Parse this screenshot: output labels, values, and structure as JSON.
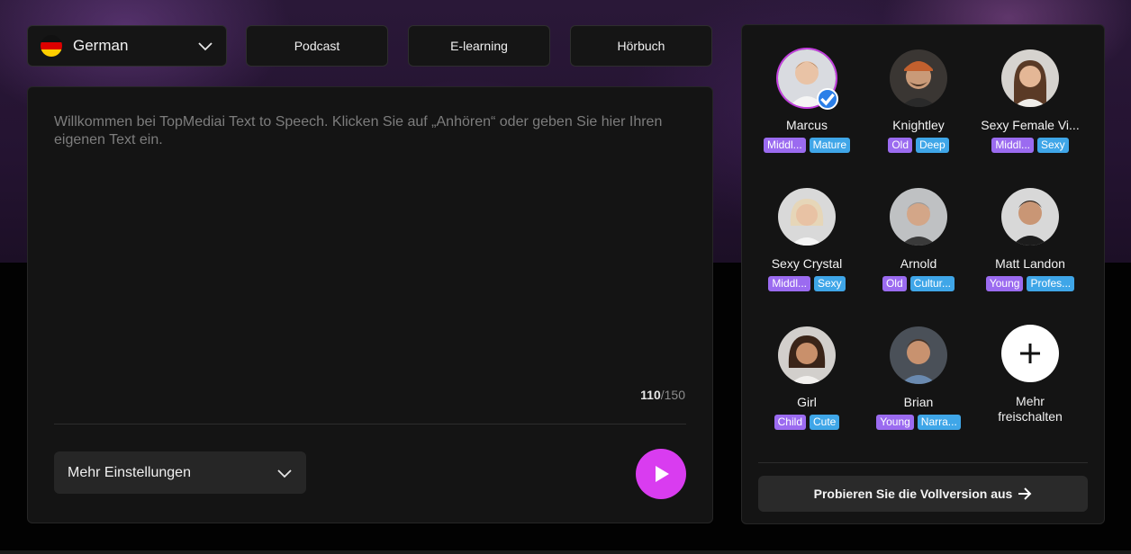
{
  "language": {
    "label": "German",
    "icon": "germany-flag-icon"
  },
  "tabs": [
    {
      "label": "Podcast"
    },
    {
      "label": "E-learning"
    },
    {
      "label": "Hörbuch"
    }
  ],
  "editor": {
    "placeholder": "Willkommen bei TopMediai Text to Speech. Klicken Sie auf „Anhören“ oder geben Sie hier Ihren eigenen Text ein.",
    "count_current": "110",
    "count_max": "/150",
    "settings_label": "Mehr Einstellungen",
    "play_icon": "play-icon"
  },
  "voices": [
    {
      "name": "Marcus",
      "tags": [
        "Middl...",
        "Mature"
      ],
      "selected": true
    },
    {
      "name": "Knightley",
      "tags": [
        "Old",
        "Deep"
      ]
    },
    {
      "name": "Sexy Female Vi...",
      "tags": [
        "Middl...",
        "Sexy"
      ]
    },
    {
      "name": "Sexy Crystal",
      "tags": [
        "Middl...",
        "Sexy"
      ]
    },
    {
      "name": "Arnold",
      "tags": [
        "Old",
        "Cultur..."
      ]
    },
    {
      "name": "Matt Landon",
      "tags": [
        "Young",
        "Profes..."
      ]
    },
    {
      "name": "Girl",
      "tags": [
        "Child",
        "Cute"
      ]
    },
    {
      "name": "Brian",
      "tags": [
        "Young",
        "Narra..."
      ]
    }
  ],
  "more": {
    "line1": "Mehr",
    "line2": "freischalten"
  },
  "try_full": {
    "label": "Probieren Sie die Vollversion aus"
  },
  "colors": {
    "accent": "#d93cf0",
    "tag_purple": "#9b6bf0",
    "tag_blue": "#3fa6e8",
    "check": "#2b7fe8"
  }
}
